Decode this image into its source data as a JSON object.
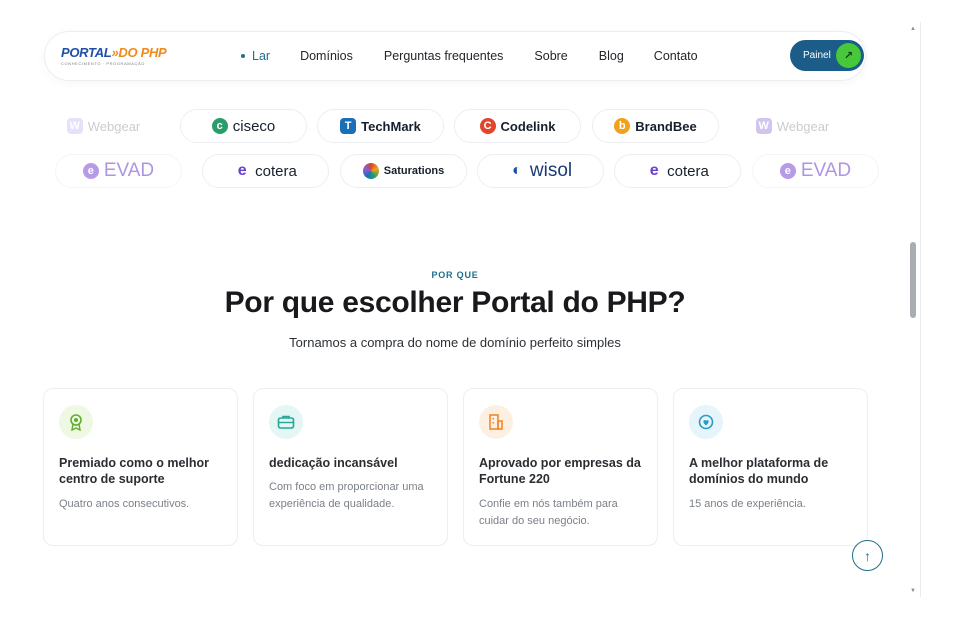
{
  "header": {
    "logo_main_a": "PORTAL",
    "logo_main_b": "DO PHP",
    "logo_sub": "CONHECIMENTO · PROGRAMAÇÃO",
    "nav": [
      {
        "label": "Lar",
        "active": true
      },
      {
        "label": "Domínios",
        "active": false
      },
      {
        "label": "Perguntas frequentes",
        "active": false
      },
      {
        "label": "Sobre",
        "active": false
      },
      {
        "label": "Blog",
        "active": false
      },
      {
        "label": "Contato",
        "active": false
      }
    ],
    "cta_label": "Painel",
    "cta_icon": "arrow-up-right-icon"
  },
  "cropped_text": "partial line hidden behind header",
  "brands_row1": [
    {
      "name": "Webgear",
      "icon": "webgear-logo",
      "color": "#b9a8e8",
      "faded": true
    },
    {
      "name": "ciseco",
      "icon": "ciseco-logo",
      "color": "#2a9d6a",
      "faded": false
    },
    {
      "name": "TechMark",
      "icon": "techmark-logo",
      "color": "#1b6fb8",
      "faded": false
    },
    {
      "name": "Codelink",
      "icon": "codelink-logo",
      "color": "#e0452d",
      "faded": false
    },
    {
      "name": "BrandBee",
      "icon": "brandbee-logo",
      "color": "#f0a21c",
      "faded": false
    },
    {
      "name": "Webgear",
      "icon": "webgear-logo",
      "color": "#9b7fe0",
      "faded": true
    }
  ],
  "brands_row2": [
    {
      "name": "EVAD",
      "icon": "evad-logo",
      "color": "#8a5ad8",
      "faded": true
    },
    {
      "name": "cotera",
      "icon": "cotera-logo",
      "color": "#6a3fd0",
      "faded": false
    },
    {
      "name": "Saturations",
      "icon": "saturations-logo",
      "color": "#d8452c",
      "faded": false
    },
    {
      "name": "wisol",
      "icon": "wisol-logo",
      "color": "#1c4aa8",
      "faded": false
    },
    {
      "name": "cotera",
      "icon": "cotera-logo",
      "color": "#6a3fd0",
      "faded": false
    },
    {
      "name": "EVAD",
      "icon": "evad-logo",
      "color": "#8a5ad8",
      "faded": true
    }
  ],
  "section": {
    "eyebrow": "POR QUE",
    "title": "Por que escolher Portal do PHP?",
    "subtitle": "Tornamos a compra do nome de domínio perfeito simples"
  },
  "features": [
    {
      "title": "Premiado como o melhor centro de suporte",
      "desc": "Quatro anos consecutivos.",
      "icon": "award-icon",
      "icon_bg": "#eef8e3",
      "icon_color": "#5fae2e"
    },
    {
      "title": "dedicação incansável",
      "desc": "Com foco em proporcionar uma experiência de qualidade.",
      "icon": "briefcase-icon",
      "icon_bg": "#e4f7f4",
      "icon_color": "#27a596"
    },
    {
      "title": "Aprovado por empresas da Fortune 220",
      "desc": "Confie em nós também para cuidar do seu negócio.",
      "icon": "building-icon",
      "icon_bg": "#fdf0e3",
      "icon_color": "#ef8a2c"
    },
    {
      "title": "A melhor plataforma de domínios do mundo",
      "desc": "15 anos de experiência.",
      "icon": "heart-shield-icon",
      "icon_bg": "#e6f5fb",
      "icon_color": "#2a9cc4"
    }
  ],
  "back_to_top_icon": "arrow-up-icon"
}
